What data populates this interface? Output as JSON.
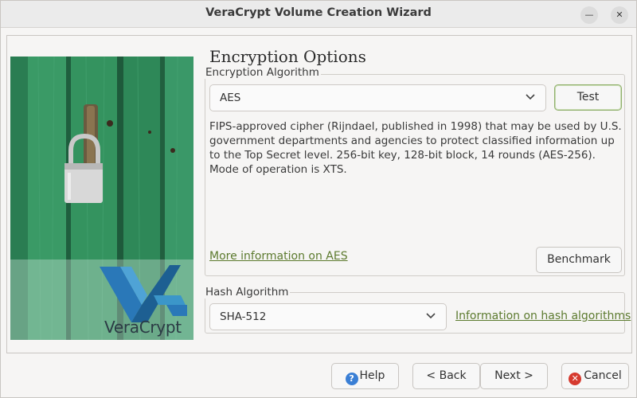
{
  "window": {
    "title": "VeraCrypt Volume Creation Wizard",
    "minimize_glyph": "—",
    "close_glyph": "✕"
  },
  "page": {
    "title": "Encryption Options"
  },
  "encryption": {
    "group_label": "Encryption Algorithm",
    "selected": "AES",
    "test_label": "Test",
    "description": "FIPS-approved cipher (Rijndael, published in 1998) that may be used by U.S. government departments and agencies to protect classified information up to the Top Secret level. 256-bit key, 128-bit block, 14 rounds (AES-256). Mode of operation is XTS.",
    "more_info_link": "More information on AES",
    "benchmark_label": "Benchmark"
  },
  "hash": {
    "group_label": "Hash Algorithm",
    "selected": "SHA-512",
    "info_link": "Information on hash algorithms"
  },
  "image": {
    "brand_text": "VeraCrypt",
    "icons": [
      "padlock-icon",
      "veracrypt-logo-icon"
    ]
  },
  "footer": {
    "help_label": "Help",
    "back_label": "< Back",
    "next_label": "Next >",
    "cancel_label": "Cancel",
    "help_icon_glyph": "?",
    "cancel_icon_glyph": "✕"
  },
  "colors": {
    "link": "#5c7a2e",
    "focus_border": "#8fb06b",
    "help_icon": "#3a7fd5",
    "cancel_icon": "#d63a2f"
  }
}
